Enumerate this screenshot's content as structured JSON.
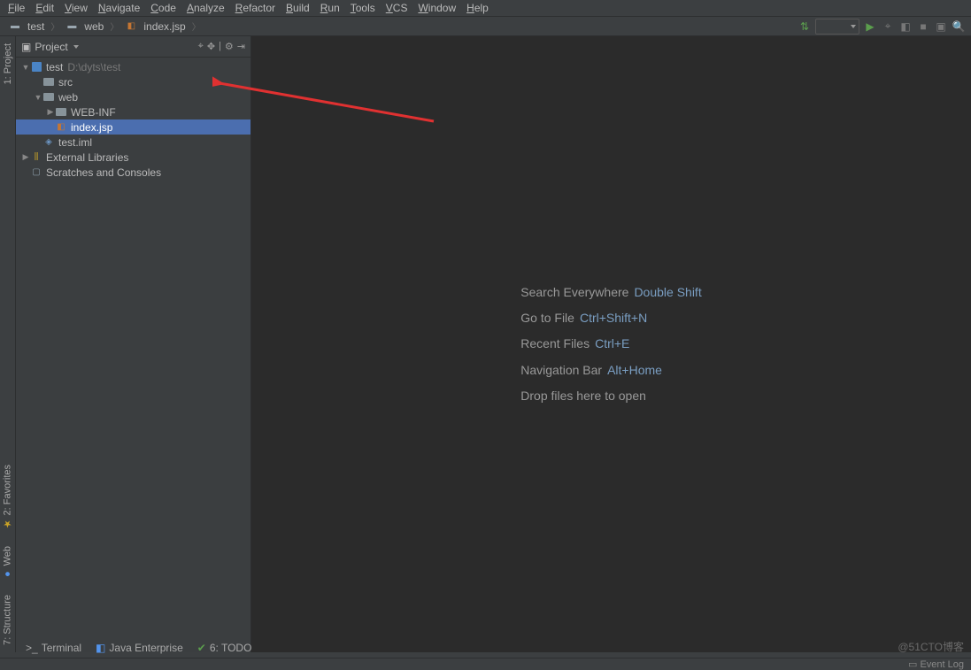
{
  "menu": [
    "File",
    "Edit",
    "View",
    "Navigate",
    "Code",
    "Analyze",
    "Refactor",
    "Build",
    "Run",
    "Tools",
    "VCS",
    "Window",
    "Help"
  ],
  "breadcrumbs": [
    {
      "icon": "folder",
      "label": "test"
    },
    {
      "icon": "folder",
      "label": "web"
    },
    {
      "icon": "jsp",
      "label": "index.jsp"
    }
  ],
  "panel": {
    "title": "Project"
  },
  "tree": [
    {
      "depth": 0,
      "arrow": "down",
      "icon": "module",
      "label": "test",
      "suffix": "D:\\dyts\\test"
    },
    {
      "depth": 1,
      "arrow": "none",
      "icon": "folder",
      "label": "src"
    },
    {
      "depth": 1,
      "arrow": "down",
      "icon": "folder",
      "label": "web"
    },
    {
      "depth": 2,
      "arrow": "right",
      "icon": "folder",
      "label": "WEB-INF"
    },
    {
      "depth": 2,
      "arrow": "none",
      "icon": "jsp",
      "label": "index.jsp",
      "selected": true
    },
    {
      "depth": 1,
      "arrow": "none",
      "icon": "iml",
      "label": "test.iml"
    },
    {
      "depth": 0,
      "arrow": "right",
      "icon": "lib",
      "label": "External Libraries"
    },
    {
      "depth": 0,
      "arrow": "none",
      "icon": "scratch",
      "label": "Scratches and Consoles"
    }
  ],
  "welcome": {
    "lines": [
      {
        "text": "Search Everywhere",
        "shortcut": "Double Shift"
      },
      {
        "text": "Go to File",
        "shortcut": "Ctrl+Shift+N"
      },
      {
        "text": "Recent Files",
        "shortcut": "Ctrl+E"
      },
      {
        "text": "Navigation Bar",
        "shortcut": "Alt+Home"
      },
      {
        "text": "Drop files here to open",
        "shortcut": ""
      }
    ]
  },
  "bottom_tabs": [
    {
      "icon": "terminal",
      "label": "Terminal"
    },
    {
      "icon": "java",
      "label": "Java Enterprise"
    },
    {
      "icon": "todo",
      "label": "6: TODO"
    }
  ],
  "left_gutter": {
    "top": "1: Project",
    "bottom": [
      "2: Favorites",
      "Web",
      "7: Structure"
    ]
  },
  "status": {
    "event_log": "Event Log"
  },
  "watermark": "@51CTO博客"
}
